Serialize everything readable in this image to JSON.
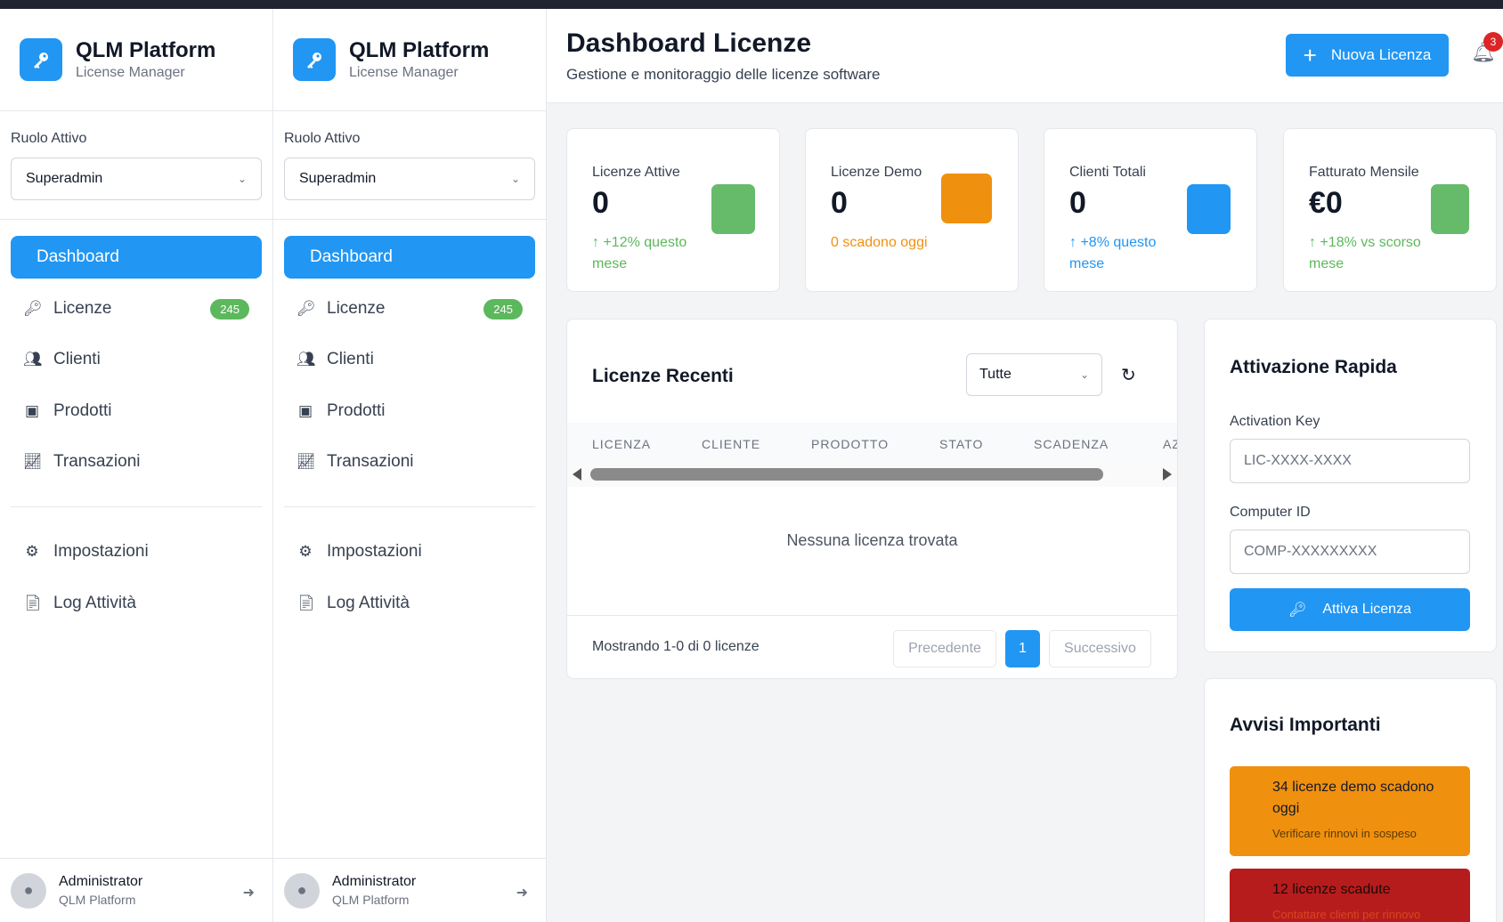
{
  "brand": {
    "title": "QLM Platform",
    "subtitle": "License Manager"
  },
  "role": {
    "label": "Ruolo Attivo",
    "value": "Superadmin"
  },
  "nav": {
    "dashboard": "Dashboard",
    "licenze": "Licenze",
    "licenze_badge": "245",
    "clienti": "Clienti",
    "prodotti": "Prodotti",
    "transazioni": "Transazioni",
    "impostazioni": "Impostazioni",
    "log": "Log Attività"
  },
  "user": {
    "name": "Administrator",
    "org": "QLM Platform"
  },
  "header": {
    "title": "Dashboard Licenze",
    "subtitle": "Gestione e monitoraggio delle licenze software",
    "new_button": "Nuova Licenza",
    "notifications": "3"
  },
  "stats": [
    {
      "label": "Licenze Attive",
      "value": "0",
      "trend": "↑ +12% questo mese",
      "color": "#66bb6a"
    },
    {
      "label": "Licenze Demo",
      "value": "0",
      "trend": "0 scadono oggi",
      "color": "#f0900f"
    },
    {
      "label": "Clienti Totali",
      "value": "0",
      "trend": "↑ +8% questo mese",
      "color": "#2196f3"
    },
    {
      "label": "Fatturato Mensile",
      "value": "€0",
      "trend": "↑ +18% vs scorso mese",
      "color": "#66bb6a"
    }
  ],
  "recent": {
    "title": "Licenze Recenti",
    "filter": "Tutte",
    "columns": [
      "LICENZA",
      "CLIENTE",
      "PRODOTTO",
      "STATO",
      "SCADENZA",
      "AZ"
    ],
    "empty": "Nessuna licenza trovata",
    "showing": "Mostrando 1-0 di 0 licenze",
    "prev": "Precedente",
    "page": "1",
    "next": "Successivo"
  },
  "quick": {
    "title": "Attivazione Rapida",
    "key_label": "Activation Key",
    "key_placeholder": "LIC-XXXX-XXXX",
    "computer_label": "Computer ID",
    "computer_placeholder": "COMP-XXXXXXXXX",
    "button": "Attiva Licenza"
  },
  "alerts": {
    "title": "Avvisi Importanti",
    "items": [
      {
        "title": "34 licenze demo scadono oggi",
        "sub": "Verificare rinnovi in sospeso"
      },
      {
        "title": "12 licenze scadute",
        "sub": "Contattare clienti per rinnovo"
      }
    ]
  }
}
